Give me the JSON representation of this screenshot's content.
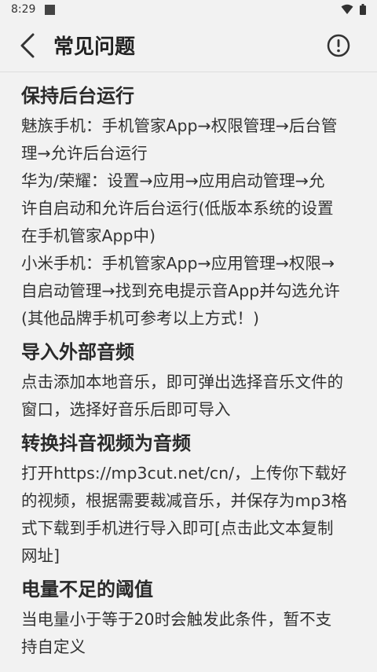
{
  "status_bar": {
    "time": "8:29"
  },
  "header": {
    "title": "常见问题"
  },
  "faqs": [
    {
      "title": "保持后台运行",
      "lines": [
        "魅族手机：手机管家App→权限管理→后台管",
        "理→允许后台运行",
        "华为/荣耀：设置→应用→应用启动管理→允",
        "许自启动和允许后台运行(低版本系统的设置",
        "在手机管家App中)",
        "小米手机：手机管家App→应用管理→权限→",
        "自启动管理→找到充电提示音App并勾选允许",
        "(其他品牌手机可参考以上方式！)"
      ]
    },
    {
      "title": "导入外部音频",
      "lines": [
        "点击添加本地音乐，即可弹出选择音乐文件的",
        "窗口，选择好音乐后即可导入"
      ]
    },
    {
      "title": "转换抖音视频为音频",
      "lines": [
        "打开https://mp3cut.net/cn/，上传你下载好",
        "的视频，根据需要裁减音乐，并保存为mp3格",
        "式下载到手机进行导入即可[点击此文本复制",
        "网址]"
      ]
    },
    {
      "title": "电量不足的阈值",
      "lines": [
        "当电量小于等于20时会触发此条件，暂不支",
        "持自定义"
      ]
    }
  ]
}
